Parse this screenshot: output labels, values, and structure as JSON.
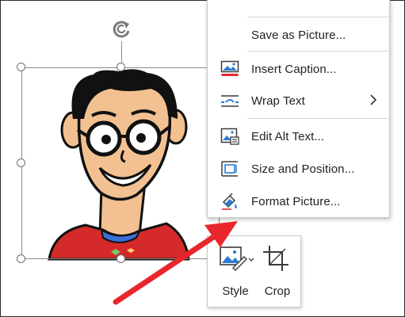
{
  "context_menu": {
    "items": [
      {
        "label": "Save as Picture...",
        "icon": "save-picture-icon"
      },
      {
        "label": "Insert Caption...",
        "icon": "insert-caption-icon"
      },
      {
        "label": "Wrap Text",
        "icon": "wrap-text-icon",
        "submenu": true
      },
      {
        "label": "Edit Alt Text...",
        "icon": "alt-text-icon"
      },
      {
        "label": "Size and Position...",
        "icon": "size-position-icon"
      },
      {
        "label": "Format Picture...",
        "icon": "format-picture-icon"
      }
    ]
  },
  "mini_toolbar": {
    "style_label": "Style",
    "crop_label": "Crop"
  },
  "colors": {
    "accent_blue": "#2b7cd3",
    "annotation_arrow": "#e8262c",
    "shirt_red": "#d42a2a",
    "skin": "#f3c191"
  }
}
